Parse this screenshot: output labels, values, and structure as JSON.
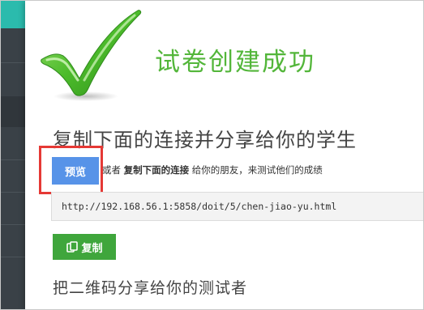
{
  "modal": {
    "success_title": "试卷创建成功",
    "share_heading": "复制下面的连接并分享给你的学生",
    "preview_button": "预览",
    "instruction": {
      "prefix": "或者 ",
      "bold": "复制下面的连接",
      "suffix": " 给你的朋友，来测试他们的成绩"
    },
    "share_url": "http://192.168.56.1:5858/doit/5/chen-jiao-yu.html",
    "copy_button": "复制",
    "qr_heading": "把二维码分享给你的测试者"
  },
  "icons": {
    "success": "check-mark-icon",
    "copy": "copy-icon"
  },
  "colors": {
    "success_green": "#53b63a",
    "preview_blue": "#5793e8",
    "copy_green": "#3fa63c",
    "highlight_red": "#e53935",
    "sidebar_dark": "#3a4147",
    "sidebar_teal": "#2bbbad"
  }
}
